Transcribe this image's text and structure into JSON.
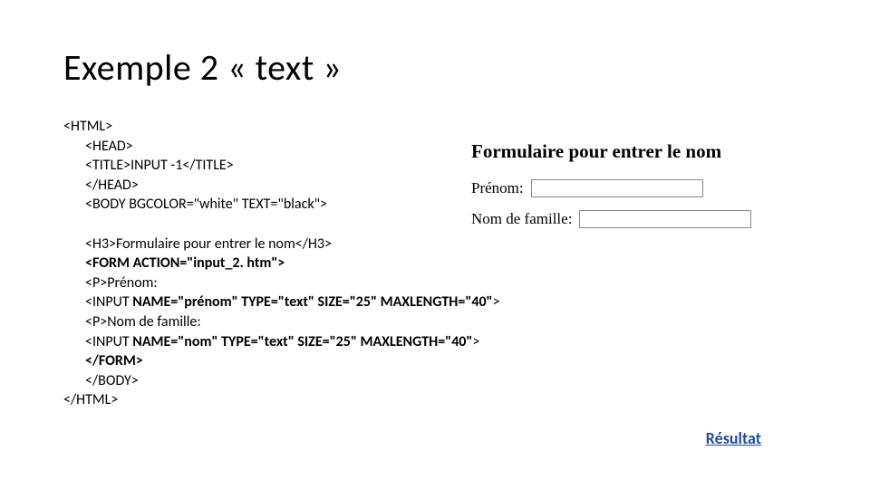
{
  "title": "Exemple 2 « text »",
  "code": {
    "l1": "<HTML>",
    "l2": "<HEAD>",
    "l3": "<TITLE>INPUT -1</TITLE>",
    "l4": "</HEAD>",
    "l5": "<BODY BGCOLOR=\"white\" TEXT=\"black\">",
    "l6": "<H3>Formulaire pour entrer le nom</H3>",
    "l7": "<FORM ACTION=\"input_2. htm\">",
    "l8": "<P>Prénom:",
    "l9a": "<INPUT ",
    "l9b": "NAME=\"prénom\" TYPE=\"text\" SIZE=\"25\" MAXLENGTH=\"40\"",
    "l9c": ">",
    "l10": "<P>Nom de famille:",
    "l11a": "<INPUT ",
    "l11b": "NAME=\"nom\" TYPE=\"text\" SIZE=\"25\" MAXLENGTH=\"40\"",
    "l11c": ">",
    "l12": "</FORM>",
    "l13": "</BODY>",
    "l14": "</HTML>"
  },
  "preview": {
    "heading": "Formulaire pour entrer le nom",
    "label_prenom": "Prénom:",
    "label_nom": "Nom de famille:"
  },
  "result_link": "Résultat"
}
